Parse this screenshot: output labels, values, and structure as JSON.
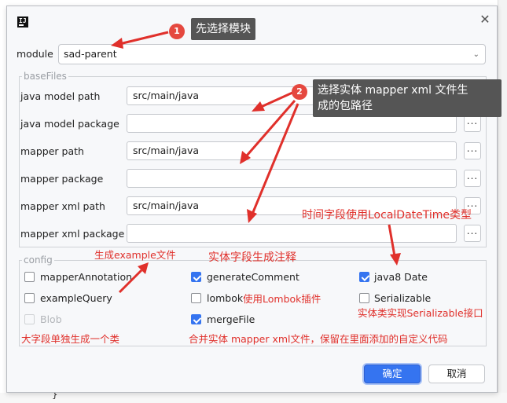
{
  "dialog": {
    "logo_text": "IJ",
    "close_glyph": "✕",
    "module_label": "module",
    "module_value": "sad-parent",
    "basefiles_legend": "baseFiles",
    "fields": [
      {
        "label": "java model path",
        "value": "src/main/java"
      },
      {
        "label": "java model package",
        "value": ""
      },
      {
        "label": "mapper path",
        "value": "src/main/java"
      },
      {
        "label": "mapper package",
        "value": ""
      },
      {
        "label": "mapper xml path",
        "value": "src/main/java"
      },
      {
        "label": "mapper xml package",
        "value": ""
      }
    ],
    "browse_label": "...",
    "config_legend": "config",
    "checkboxes": [
      {
        "label": "mapperAnnotation",
        "checked": false,
        "disabled": false
      },
      {
        "label": "exampleQuery",
        "checked": false,
        "disabled": false
      },
      {
        "label": "Blob",
        "checked": false,
        "disabled": true
      },
      {
        "label": "generateComment",
        "checked": true,
        "disabled": false
      },
      {
        "label": "lombok",
        "checked": false,
        "disabled": false
      },
      {
        "label": "mergeFile",
        "checked": true,
        "disabled": false
      },
      {
        "label": "java8 Date",
        "checked": true,
        "disabled": false
      },
      {
        "label": "Serializable",
        "checked": false,
        "disabled": false
      }
    ],
    "ok_label": "确定",
    "cancel_label": "取消"
  },
  "annotations": {
    "badge1": "1",
    "tip1": "先选择模块",
    "badge2": "2",
    "tip2_line1": "选择实体 mapper xml 文件生",
    "tip2_line2": "成的包路径",
    "note_datetime": "时间字段使用LocalDateTime类型",
    "note_example": "生成example文件",
    "note_comment": "实体字段生成注释",
    "note_lombok": "使用Lombok插件",
    "note_serializable": "实体类实现Serializable接口",
    "note_blob": "大字段单独生成一个类",
    "note_merge": "合并实体 mapper xml文件，保留在里面添加的自定义代码"
  },
  "colors": {
    "accent": "#3574f0",
    "annotation_red": "#e0302b",
    "tooltip_bg": "#555555"
  }
}
